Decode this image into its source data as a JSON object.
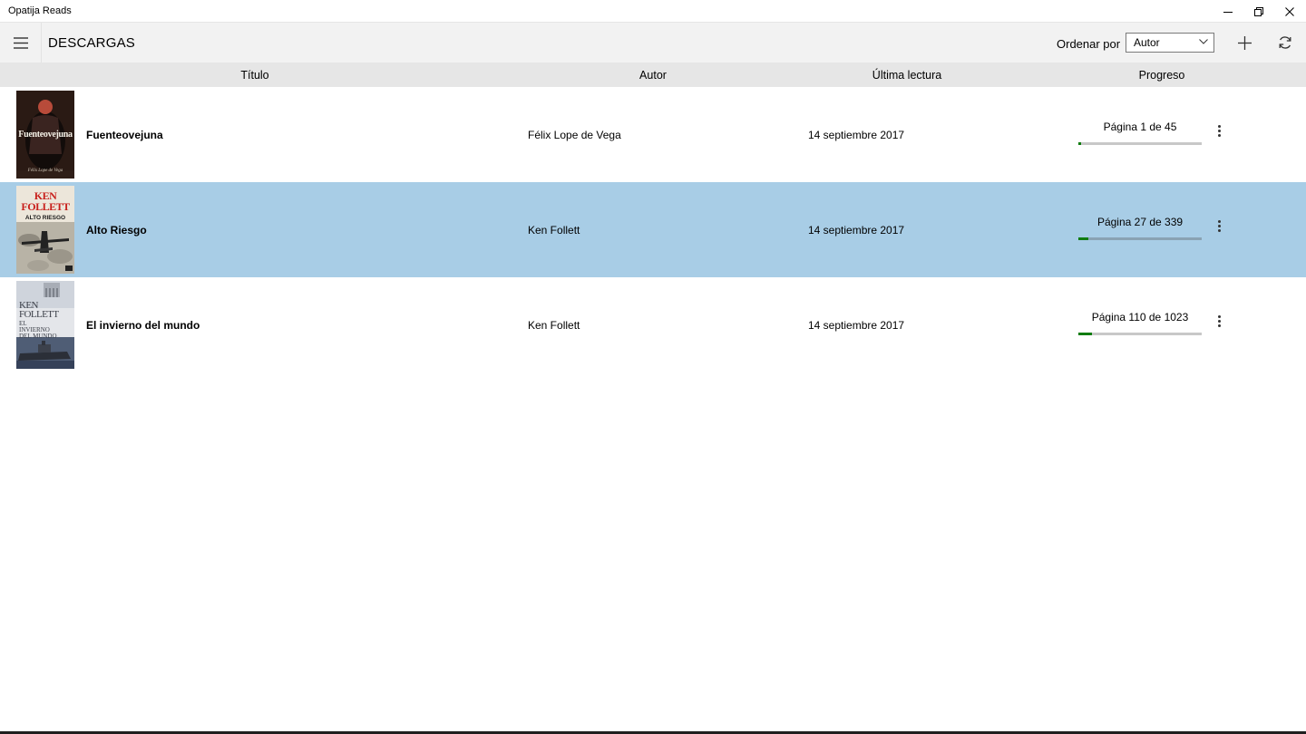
{
  "window": {
    "title": "Opatija Reads"
  },
  "header": {
    "page_title": "DESCARGAS",
    "sort_label": "Ordenar por",
    "sort_value": "Autor"
  },
  "columns": {
    "title": "Título",
    "author": "Autor",
    "last_read": "Última lectura",
    "progress": "Progreso"
  },
  "books": [
    {
      "title": "Fuenteovejuna",
      "author": "Félix Lope de Vega",
      "last_read": "14 septiembre 2017",
      "progress_text": "Página 1 de 45",
      "progress_fraction": 0.022,
      "selected": false,
      "cover": {
        "title_text": "Fuenteovejuna",
        "author_text": "Félix Lope de Vega"
      }
    },
    {
      "title": "Alto Riesgo",
      "author": "Ken Follett",
      "last_read": "14 septiembre 2017",
      "progress_text": "Página 27 de 339",
      "progress_fraction": 0.08,
      "selected": true,
      "cover": {
        "title_text": "ALTO RIESGO",
        "author_text": "KEN FOLLETT"
      }
    },
    {
      "title": "El invierno del mundo",
      "author": "Ken Follett",
      "last_read": "14 septiembre 2017",
      "progress_text": "Página 110 de 1023",
      "progress_fraction": 0.108,
      "selected": false,
      "cover": {
        "title_text": "EL INVIERNO DEL MUNDO",
        "author_text": "KEN FOLLETT"
      }
    }
  ],
  "colors": {
    "selection": "#a8cde6",
    "progress_fill": "#107c10",
    "appbar": "#f2f2f2",
    "column_header": "#e6e6e6"
  },
  "icons": [
    "hamburger-icon",
    "add-icon",
    "refresh-icon",
    "more-vertical-icon",
    "chevron-down-icon",
    "minimize-icon",
    "restore-icon",
    "close-icon"
  ]
}
